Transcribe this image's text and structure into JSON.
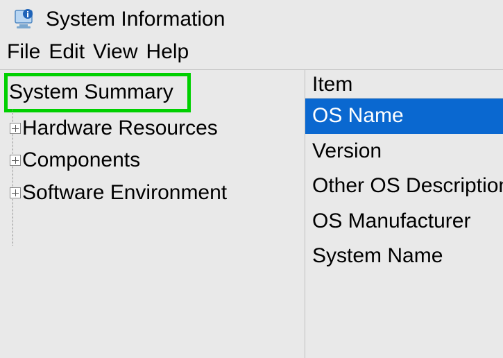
{
  "titlebar": {
    "icon": "system-info-icon",
    "title": "System Information"
  },
  "menubar": {
    "items": [
      "File",
      "Edit",
      "View",
      "Help"
    ]
  },
  "tree": {
    "root_label": "System Summary",
    "children": [
      {
        "label": "Hardware Resources",
        "expandable": true
      },
      {
        "label": "Components",
        "expandable": true
      },
      {
        "label": "Software Environment",
        "expandable": true
      }
    ],
    "selected": "System Summary",
    "highlight_color": "#00d000"
  },
  "list": {
    "header": {
      "col1": "Item"
    },
    "rows": [
      {
        "item": "OS Name",
        "selected": true
      },
      {
        "item": "Version",
        "selected": false
      },
      {
        "item": "Other OS Description",
        "selected": false
      },
      {
        "item": "OS Manufacturer",
        "selected": false
      },
      {
        "item": "System Name",
        "selected": false
      }
    ],
    "selection_bg": "#0a68d0"
  }
}
